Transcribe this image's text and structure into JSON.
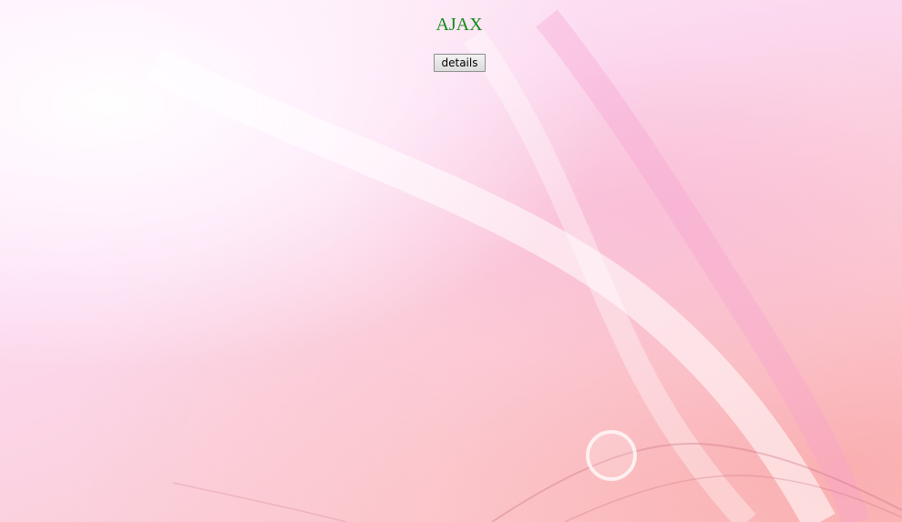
{
  "page": {
    "title": "AJAX"
  },
  "details_button": {
    "label": "details"
  },
  "colors": {
    "title": "#168a16",
    "background_light": "#fef3fb",
    "background_pink": "#fcdaf0",
    "background_salmon": "#fac2c6"
  }
}
